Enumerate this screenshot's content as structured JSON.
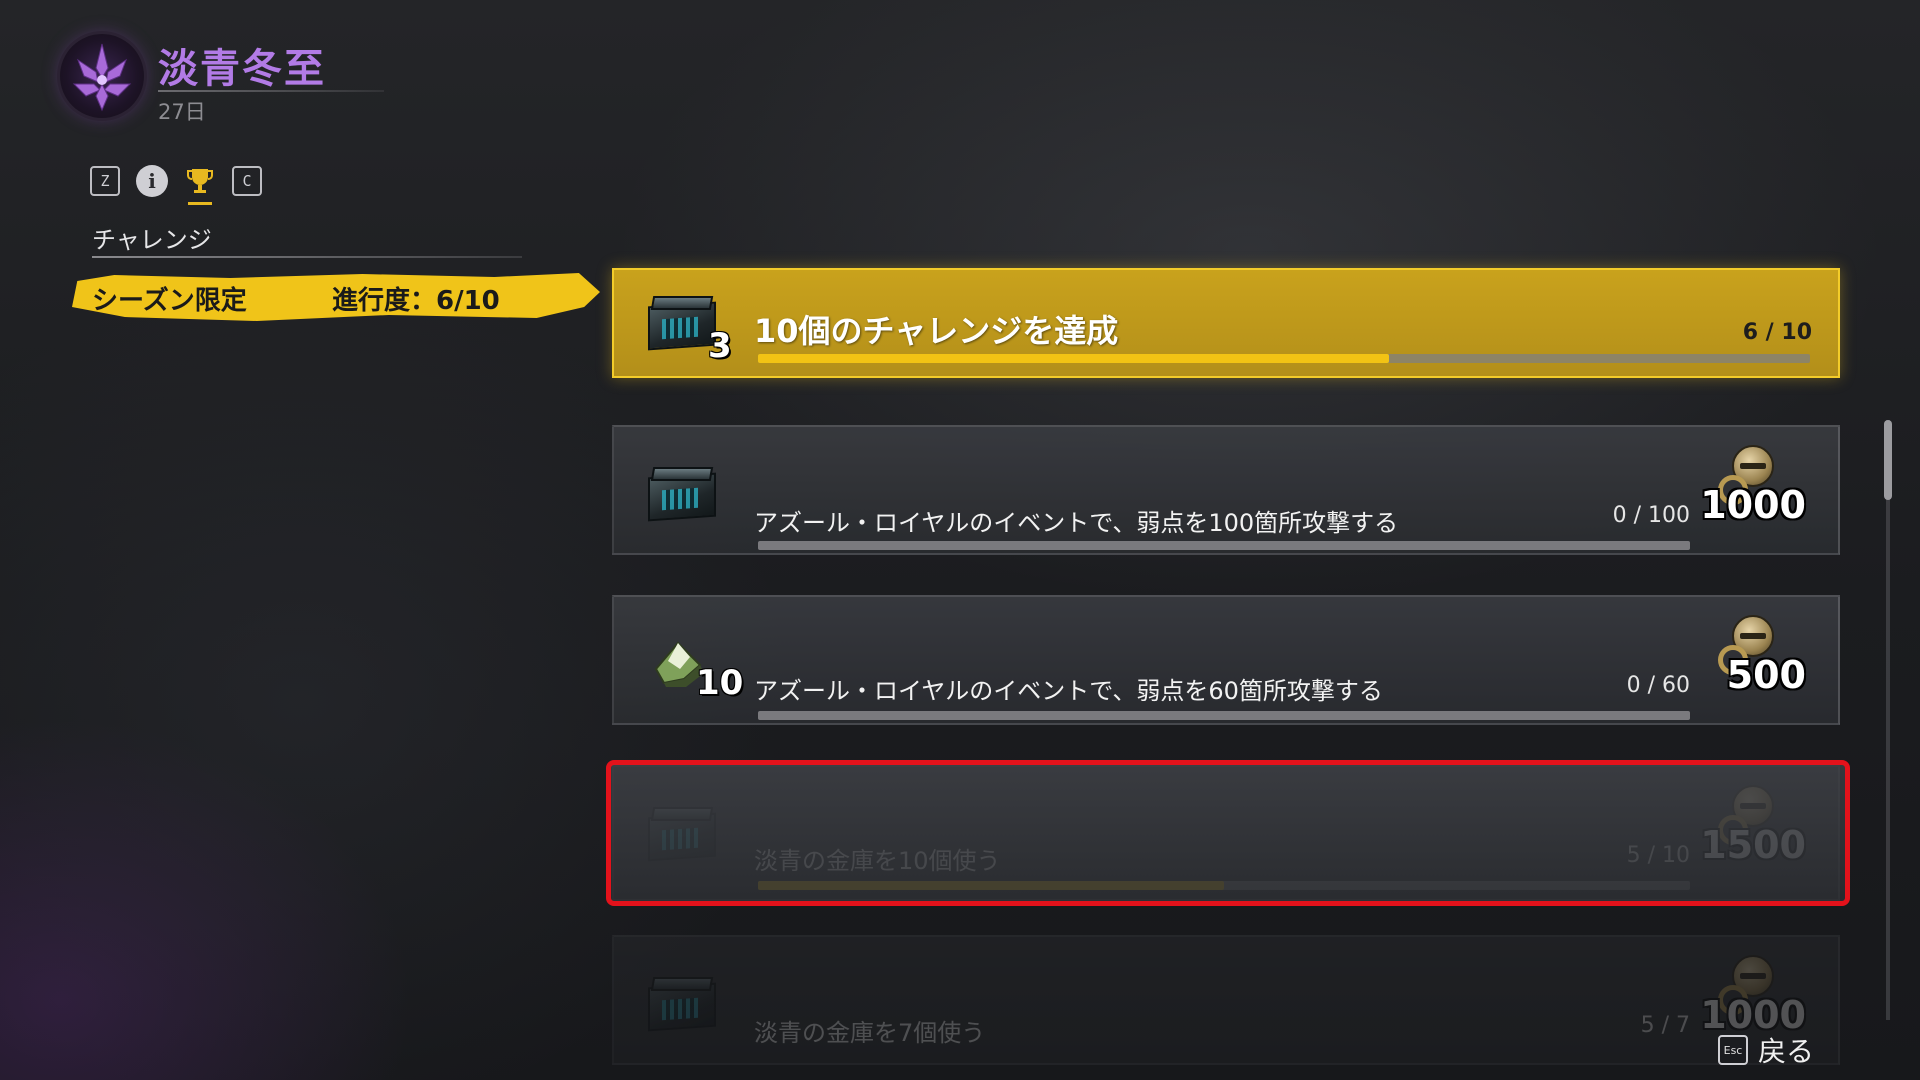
{
  "season": {
    "title": "淡青冬至",
    "days_remaining": "27日"
  },
  "tabs": [
    {
      "key": "Z",
      "icon": "z-key-icon"
    },
    {
      "key": "i",
      "icon": "info-icon"
    },
    {
      "key": "",
      "icon": "trophy-icon",
      "active": true
    },
    {
      "key": "C",
      "icon": "c-key-icon"
    }
  ],
  "section": {
    "label": "チャレンジ"
  },
  "category": {
    "name": "シーズン限定",
    "progress_text": "進行度：6/10"
  },
  "challenges": [
    {
      "title": "10個のチャレンジを達成",
      "progress_text": "6 / 10",
      "progress": 0.6,
      "reward_icon": "chest-icon",
      "reward_qty": "3",
      "featured": true
    },
    {
      "title": "アズール・ロイヤルのイベントで、弱点を100箇所攻撃する",
      "progress_text": "0 / 100",
      "progress": 0.0,
      "reward_icon": "chest-icon",
      "token_amount": "1000"
    },
    {
      "title": "アズール・ロイヤルのイベントで、弱点を60箇所攻撃する",
      "progress_text": "0 / 60",
      "progress": 0.0,
      "reward_icon": "shard-icon",
      "reward_qty": "10",
      "token_amount": "500"
    },
    {
      "title": "淡青の金庫を10個使う",
      "progress_text": "5 / 10",
      "progress": 0.5,
      "reward_icon": "chest-icon",
      "token_amount": "1500",
      "selected": true
    },
    {
      "title": "淡青の金庫を7個使う",
      "progress_text": "5 / 7",
      "progress": 0.71,
      "reward_icon": "chest-icon",
      "token_amount": "1000"
    }
  ],
  "footer": {
    "back_key": "Esc",
    "back_label": "戻る"
  },
  "colors": {
    "accent_yellow": "#f2c314",
    "season_purple": "#b27be6",
    "selection_red": "#e3121b"
  }
}
